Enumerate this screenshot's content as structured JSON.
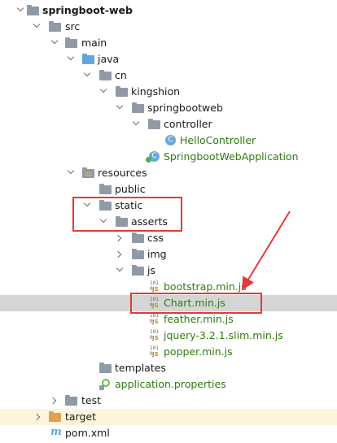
{
  "tree": {
    "root": "springboot-web",
    "src": "src",
    "main": "main",
    "java": "java",
    "cn": "cn",
    "kingshion": "kingshion",
    "springbootweb": "springbootweb",
    "controller": "controller",
    "hello_controller": "HelloController",
    "app_class": "SpringbootWebApplication",
    "resources": "resources",
    "public": "public",
    "static": "static",
    "asserts": "asserts",
    "css": "css",
    "img": "img",
    "js": "js",
    "bootstrap": "bootstrap.min.js",
    "chart": "Chart.min.js",
    "feather": "feather.min.js",
    "jquery": "jquery-3.2.1.slim.min.js",
    "popper": "popper.min.js",
    "templates": "templates",
    "app_properties": "application.properties",
    "test": "test",
    "target": "target",
    "pom": "pom.xml"
  },
  "icons": {
    "class_letter": "C",
    "js_bits": "101\n0",
    "js_label": "JS",
    "maven_letter": "m"
  },
  "colors": {
    "selection": "#d5d5d5",
    "excluded_folder_bg": "#fdf5db",
    "annotation_red": "#e53935",
    "file_green": "#2d7d0b"
  }
}
